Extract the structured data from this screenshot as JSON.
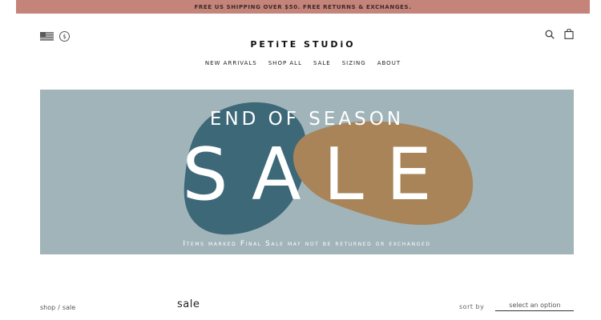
{
  "announcement": "FREE US SHIPPING OVER $50. FREE RETURNS & EXCHANGES.",
  "header": {
    "brand": "PETiTE STUDiO",
    "currency_symbol": "$",
    "icons": [
      "us-flag-icon",
      "currency-icon",
      "search-icon",
      "cart-bag-icon"
    ]
  },
  "nav": [
    "NEW ARRIVALS",
    "SHOP ALL",
    "SALE",
    "SIZING",
    "ABOUT"
  ],
  "banner": {
    "headline": "END OF SEASON",
    "title": "SALE",
    "fine_print": "Items marked Final Sale may not be returned or exchanged",
    "colors": {
      "background": "#a1b4ba",
      "blob_teal": "#3d6878",
      "blob_tan": "#a98458"
    }
  },
  "breadcrumb": {
    "home": "shop",
    "separator": "/",
    "current": "sale"
  },
  "page_title": "sale",
  "sort": {
    "label": "sort by",
    "value": "select an option"
  },
  "colors": {
    "announcement_bar": "#c5847a"
  }
}
